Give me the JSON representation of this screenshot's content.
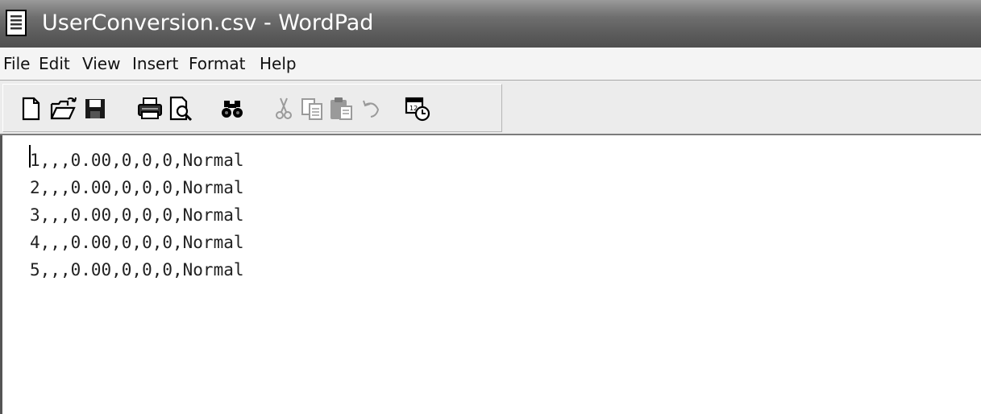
{
  "window": {
    "title": "UserConversion.csv - WordPad",
    "app_icon": "wordpad-document-icon"
  },
  "menu": {
    "items": [
      "File",
      "Edit",
      "View",
      "Insert",
      "Format",
      "Help"
    ]
  },
  "toolbar": {
    "buttons": [
      {
        "name": "new-icon",
        "enabled": true
      },
      {
        "name": "open-icon",
        "enabled": true
      },
      {
        "name": "save-icon",
        "enabled": true
      },
      {
        "name": "print-icon",
        "enabled": true
      },
      {
        "name": "print-preview-icon",
        "enabled": true
      },
      {
        "name": "find-icon",
        "enabled": true
      },
      {
        "name": "cut-icon",
        "enabled": false
      },
      {
        "name": "copy-icon",
        "enabled": false
      },
      {
        "name": "paste-icon",
        "enabled": false
      },
      {
        "name": "undo-icon",
        "enabled": false
      },
      {
        "name": "date-time-icon",
        "enabled": true
      }
    ]
  },
  "document": {
    "lines": [
      "1,,,0.00,0,0,0,Normal",
      "2,,,0.00,0,0,0,Normal",
      "3,,,0.00,0,0,0,Normal",
      "4,,,0.00,0,0,0,Normal",
      "5,,,0.00,0,0,0,Normal"
    ]
  }
}
